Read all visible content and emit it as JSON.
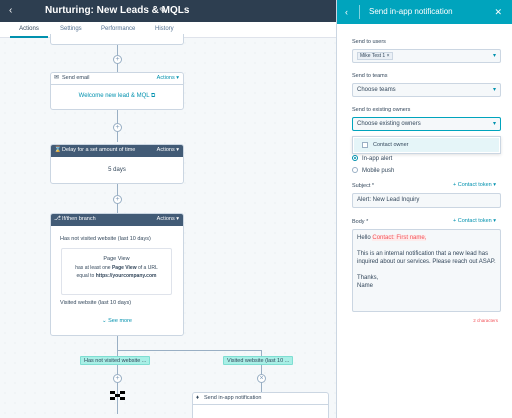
{
  "header": {
    "title": "Nurturing: New Leads & MQLs",
    "tabs": [
      "Actions",
      "Settings",
      "Performance",
      "History"
    ]
  },
  "workflow": {
    "send_email": {
      "title": "Send email",
      "actions_label": "Actions",
      "email_link": "Welcome new lead & MQL"
    },
    "delay": {
      "title": "Delay for a set amount of time",
      "actions_label": "Actions",
      "value": "5 days"
    },
    "branch": {
      "title": "If/then branch",
      "actions_label": "Actions",
      "condition_title": "Has not visited website (last 10 days)",
      "filter_name": "Page View",
      "filter_line1_pre": "has at least one",
      "filter_line1_bold": "Page View",
      "filter_line1_post": "of a URL",
      "filter_line2_pre": "equal to",
      "filter_line2_bold": "https://yourcompany.com",
      "other_branch": "Visited website (last 10 days)",
      "see_more": "See more"
    },
    "branch_pills": {
      "left": "Has not visited website ...",
      "right": "Visited website (last 10 ..."
    },
    "send_inapp": {
      "title": "Send in-app notification"
    }
  },
  "panel": {
    "title": "Send in-app notification",
    "send_to_users": {
      "label": "Send to users",
      "chip": "Mike Test 1"
    },
    "send_to_teams": {
      "label": "Send to teams",
      "placeholder": "Choose teams"
    },
    "send_to_owners": {
      "label": "Send to existing owners",
      "placeholder": "Choose existing owners",
      "options": [
        "Contact owner"
      ]
    },
    "delivery": {
      "options": [
        "In-app alert",
        "Mobile push"
      ],
      "selected": "In-app alert"
    },
    "subject": {
      "label": "Subject",
      "required": "*",
      "contact_token": "Contact token",
      "value": "Alert: New Lead Inquiry"
    },
    "body": {
      "label": "Body",
      "required": "*",
      "contact_token": "Contact token",
      "greeting": "Hello",
      "token": "Contact: First name,",
      "paragraph": "This is an internal notification that a new lead has inquired about our services. Please reach out ASAP.",
      "signoff": "Thanks,",
      "name": "Name",
      "counter": "2 characters"
    }
  },
  "colors": {
    "header_bg": "#2d3e50",
    "panel_header_bg": "#00a4bd",
    "link": "#0091ae",
    "branch_pill": "#a8efe6",
    "token": "#f2545b"
  }
}
